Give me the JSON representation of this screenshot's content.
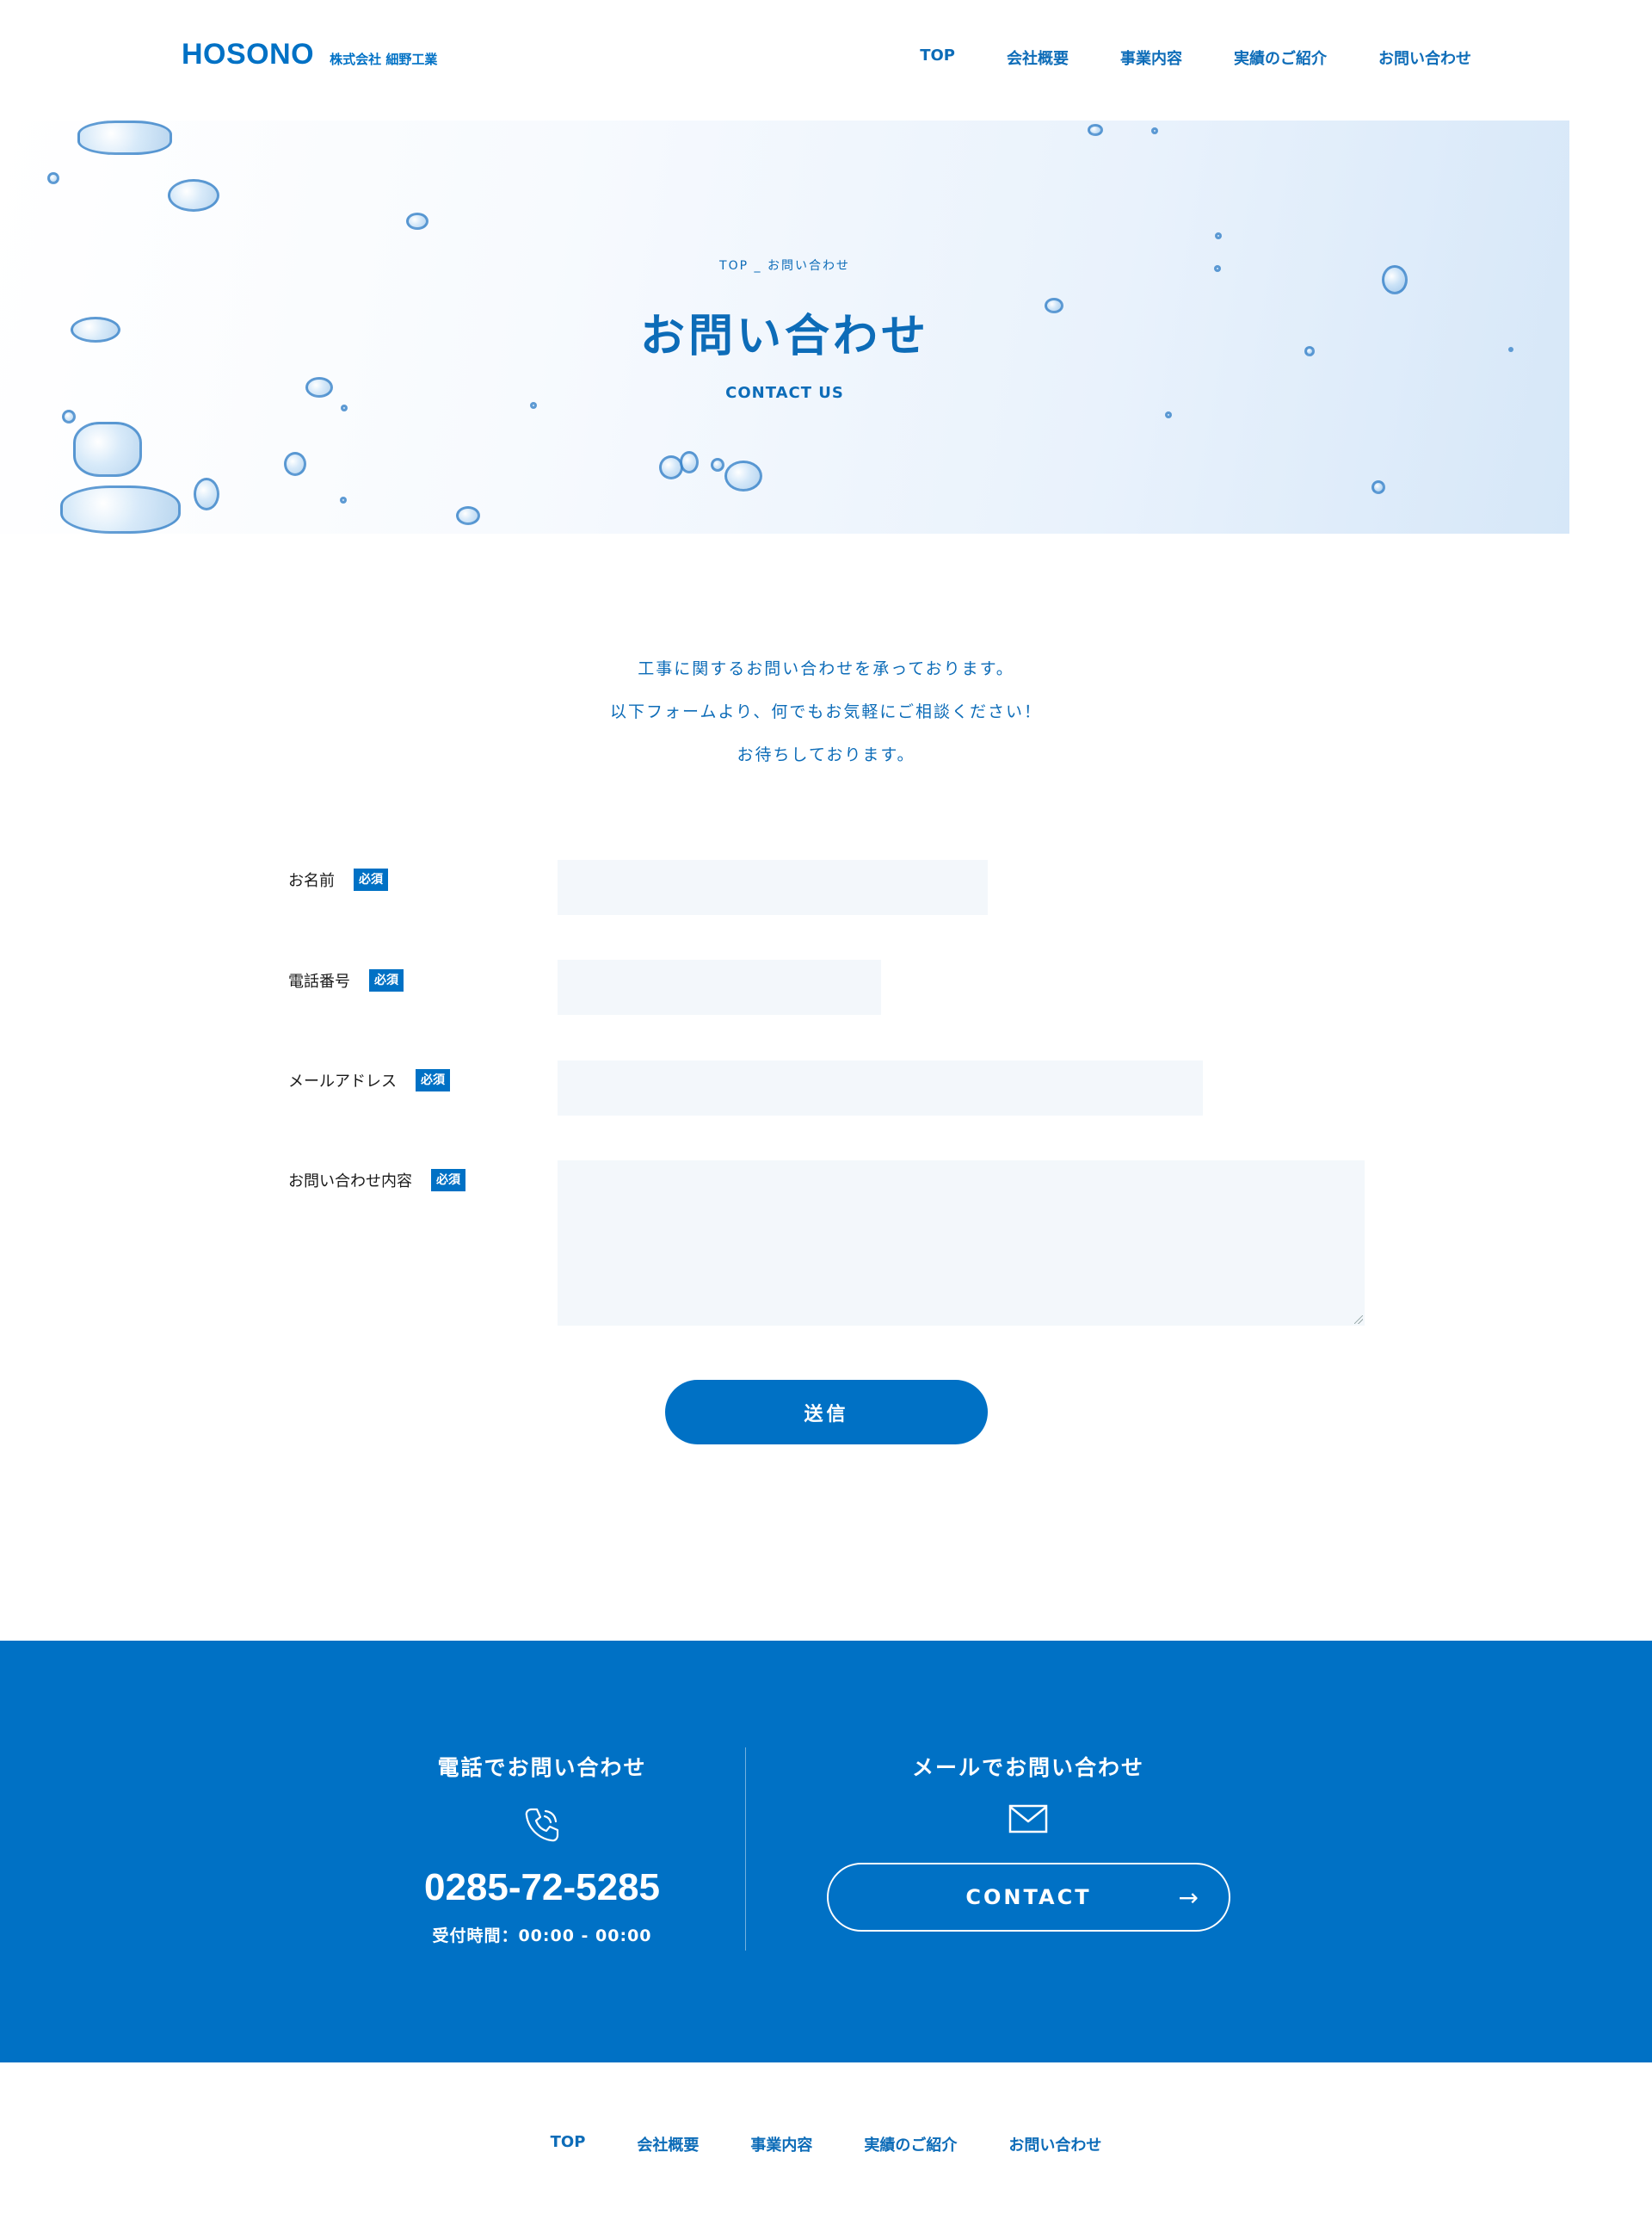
{
  "header": {
    "logo": "HOSONO",
    "company": "株式会社 細野工業",
    "nav": [
      "TOP",
      "会社概要",
      "事業内容",
      "実績のご紹介",
      "お問い合わせ"
    ]
  },
  "hero": {
    "breadcrumb": "TOP _ お問い合わせ",
    "title": "お問い合わせ",
    "subtitle": "CONTACT US"
  },
  "intro": [
    "工事に関するお問い合わせを承っております。",
    "以下フォームより、何でもお気軽にご相談ください！",
    "お待ちしております。"
  ],
  "form": {
    "required_badge": "必須",
    "fields": [
      {
        "label": "お名前",
        "value": ""
      },
      {
        "label": "電話番号",
        "value": ""
      },
      {
        "label": "メールアドレス",
        "value": ""
      },
      {
        "label": "お問い合わせ内容",
        "value": ""
      }
    ],
    "submit": "送信"
  },
  "contact_band": {
    "phone_heading": "電話でお問い合わせ",
    "phone_number": "0285-72-5285",
    "hours": "受付時間：00:00 - 00:00",
    "mail_heading": "メールでお問い合わせ",
    "contact_button": "CONTACT",
    "accent": "#0071c5"
  },
  "footer": {
    "nav": [
      "TOP",
      "会社概要",
      "事業内容",
      "実績のご紹介",
      "お問い合わせ"
    ]
  }
}
